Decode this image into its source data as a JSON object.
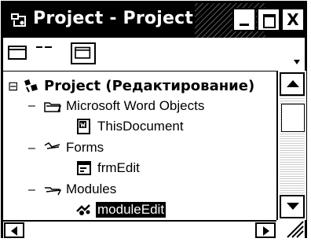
{
  "window": {
    "title": "Project - Project"
  },
  "title_buttons": {
    "close_glyph": "X"
  },
  "toolbar": {
    "buttons": [
      "view-code-icon",
      "toggle-folders-icon",
      "view-object-icon",
      "dropdown-arrow-icon"
    ]
  },
  "tree": {
    "root": {
      "label": "Project (Редактирование)",
      "expander": "⊟"
    },
    "items": [
      {
        "label": "Microsoft Word Objects",
        "expander": "–"
      },
      {
        "label": "ThisDocument"
      },
      {
        "label": "Forms",
        "expander": "–"
      },
      {
        "label": "frmEdit"
      },
      {
        "label": "Modules",
        "expander": "–"
      },
      {
        "label": "moduleEdit",
        "selected": true
      }
    ]
  },
  "colors": {
    "selection_bg": "#000000",
    "selection_fg": "#ffffff",
    "titlebar_bg": "#000000"
  }
}
